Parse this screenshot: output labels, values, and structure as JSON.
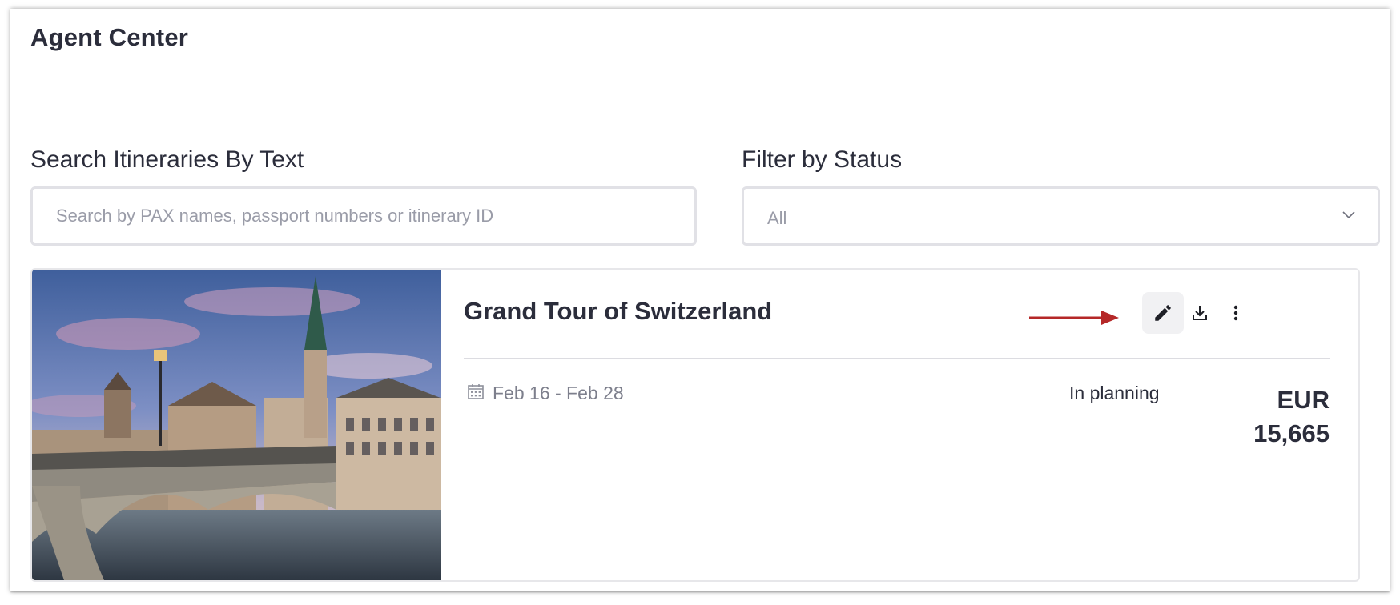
{
  "app": {
    "title": "Agent Center"
  },
  "search": {
    "label": "Search Itineraries By Text",
    "placeholder": "Search by PAX names, passport numbers or itinerary ID",
    "value": ""
  },
  "filter": {
    "label": "Filter by Status",
    "selected": "All"
  },
  "itinerary": {
    "title": "Grand Tour of Switzerland",
    "dates": "Feb 16 - Feb 28",
    "status": "In planning",
    "currency": "EUR",
    "amount": "15,665",
    "actions": {
      "edit_icon": "pencil-icon",
      "download_icon": "download-icon",
      "more_icon": "more-vertical-icon"
    }
  },
  "colors": {
    "text": "#2b2d3b",
    "muted": "#9a9ca8",
    "border": "#e1e1e6",
    "arrow": "#b52828",
    "edit_bg": "#f1f1f3"
  }
}
